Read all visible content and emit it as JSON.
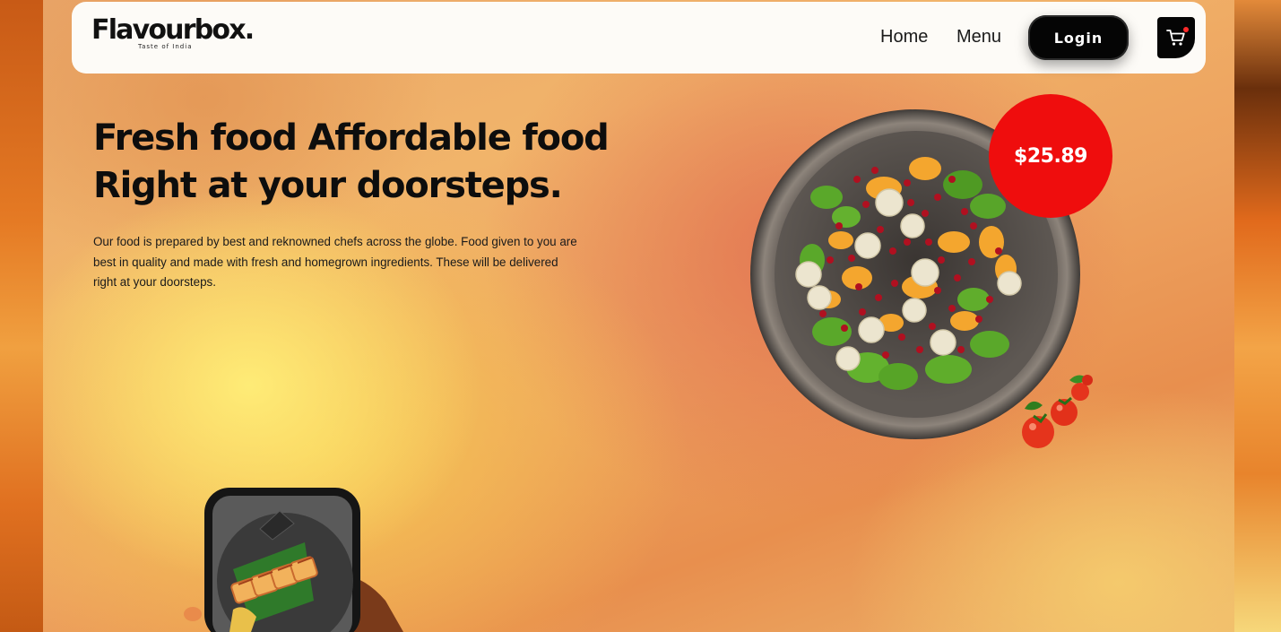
{
  "brand": {
    "name": "Flavourbox.",
    "tagline": "Taste of India"
  },
  "nav": {
    "home_label": "Home",
    "menu_label": "Menu",
    "login_label": "Login",
    "cart_icon": "cart-icon"
  },
  "hero": {
    "headline_line1": "Fresh food Affordable food",
    "headline_line2": "Right at your doorsteps.",
    "description": "Our food is prepared by best and reknowned chefs across the globe. Food given to you are best in quality and made with fresh and homegrown ingredients. These will be delivered right at your doorsteps.",
    "price": "$25.89"
  },
  "colors": {
    "accent_red": "#ef0d0d",
    "button_black": "#050505",
    "navbar_bg": "#fdfbf7"
  }
}
